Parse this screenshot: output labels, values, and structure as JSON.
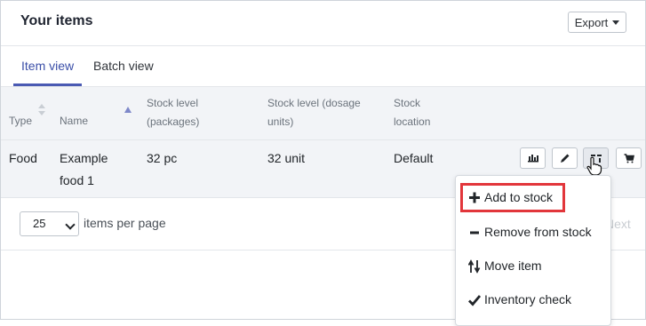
{
  "header": {
    "title": "Your items",
    "export_label": "Export"
  },
  "tabs": [
    {
      "label": "Item view",
      "active": true
    },
    {
      "label": "Batch view",
      "active": false
    }
  ],
  "table": {
    "columns": [
      {
        "line1": "Type",
        "line2": ""
      },
      {
        "line1": "Name",
        "line2": ""
      },
      {
        "line1": "Stock level",
        "line2": "(packages)"
      },
      {
        "line1": "Stock level (dosage",
        "line2": "units)"
      },
      {
        "line1": "Stock",
        "line2": "location"
      }
    ],
    "rows": [
      {
        "type": "Food",
        "name_line1": "Example",
        "name_line2": "food 1",
        "packages": "32 pc",
        "dosage_units": "32 unit",
        "location": "Default"
      }
    ],
    "row_actions": [
      {
        "icon": "bar-chart-icon"
      },
      {
        "icon": "pencil-icon"
      },
      {
        "icon": "stock-actions-icon"
      },
      {
        "icon": "cart-icon"
      }
    ]
  },
  "pagination": {
    "per_page_value": "25",
    "per_page_label": "items per page",
    "next_label": "Next"
  },
  "stock_menu": {
    "items": [
      {
        "label": "Add to stock",
        "icon": "plus-icon"
      },
      {
        "label": "Remove from stock",
        "icon": "minus-icon"
      },
      {
        "label": "Move item",
        "icon": "up-down-arrows-icon"
      },
      {
        "label": "Inventory check",
        "icon": "checkmark-icon"
      }
    ]
  },
  "colors": {
    "accent": "#4a5ab3",
    "highlight": "#e2363b",
    "header_bg": "#f2f4f7"
  }
}
